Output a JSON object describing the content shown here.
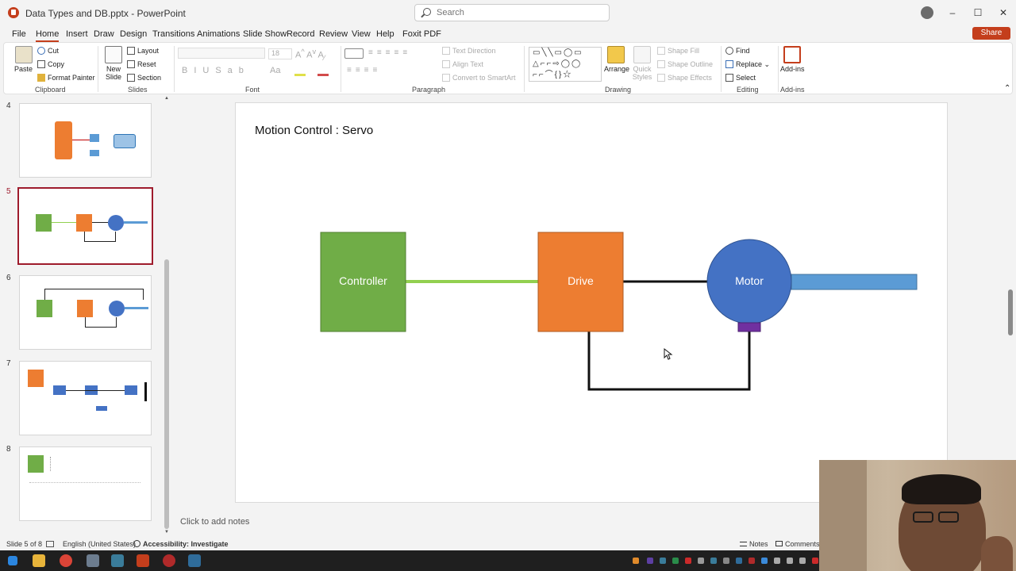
{
  "window": {
    "title": "Data Types and DB.pptx  -  PowerPoint",
    "search_placeholder": "Search",
    "minimize": "–",
    "maximize": "☐",
    "close": "✕"
  },
  "menu": {
    "tabs": [
      "File",
      "Home",
      "Insert",
      "Draw",
      "Design",
      "Transitions",
      "Animations",
      "Slide Show",
      "Record",
      "Review",
      "View",
      "Help",
      "Foxit PDF"
    ],
    "active": "Home",
    "share": "Share"
  },
  "ribbon": {
    "clipboard": {
      "label": "Clipboard",
      "paste": "Paste",
      "cut": "Cut",
      "copy": "Copy",
      "format_painter": "Format Painter"
    },
    "slides": {
      "label": "Slides",
      "new_slide": "New Slide",
      "layout": "Layout",
      "reset": "Reset",
      "section": "Section"
    },
    "font": {
      "label": "Font",
      "font_size": "18"
    },
    "paragraph": {
      "label": "Paragraph",
      "text_direction": "Text Direction",
      "align_text": "Align Text",
      "convert_smartart": "Convert to SmartArt"
    },
    "drawing": {
      "label": "Drawing",
      "arrange": "Arrange",
      "quick_styles": "Quick Styles",
      "shape_fill": "Shape Fill",
      "shape_outline": "Shape Outline",
      "shape_effects": "Shape Effects"
    },
    "editing": {
      "label": "Editing",
      "find": "Find",
      "replace": "Replace",
      "select": "Select"
    },
    "addins": {
      "label": "Add-ins",
      "addins": "Add-ins"
    }
  },
  "thumbnails": [
    {
      "num": "4"
    },
    {
      "num": "5"
    },
    {
      "num": "6"
    },
    {
      "num": "7"
    },
    {
      "num": "8"
    }
  ],
  "slide": {
    "title": "Motion Control : Servo",
    "controller": "Controller",
    "drive": "Drive",
    "motor": "Motor",
    "colors": {
      "controller": "#70ad47",
      "drive": "#ed7d31",
      "motor": "#4472c4",
      "shaft": "#5b9bd5",
      "encoder": "#7030a0",
      "link": "#92d050"
    }
  },
  "notes": {
    "placeholder": "Click to add notes"
  },
  "status": {
    "slide": "Slide 5 of 8",
    "language": "English (United States)",
    "accessibility": "Accessibility: Investigate",
    "notes": "Notes",
    "comments": "Comments"
  }
}
